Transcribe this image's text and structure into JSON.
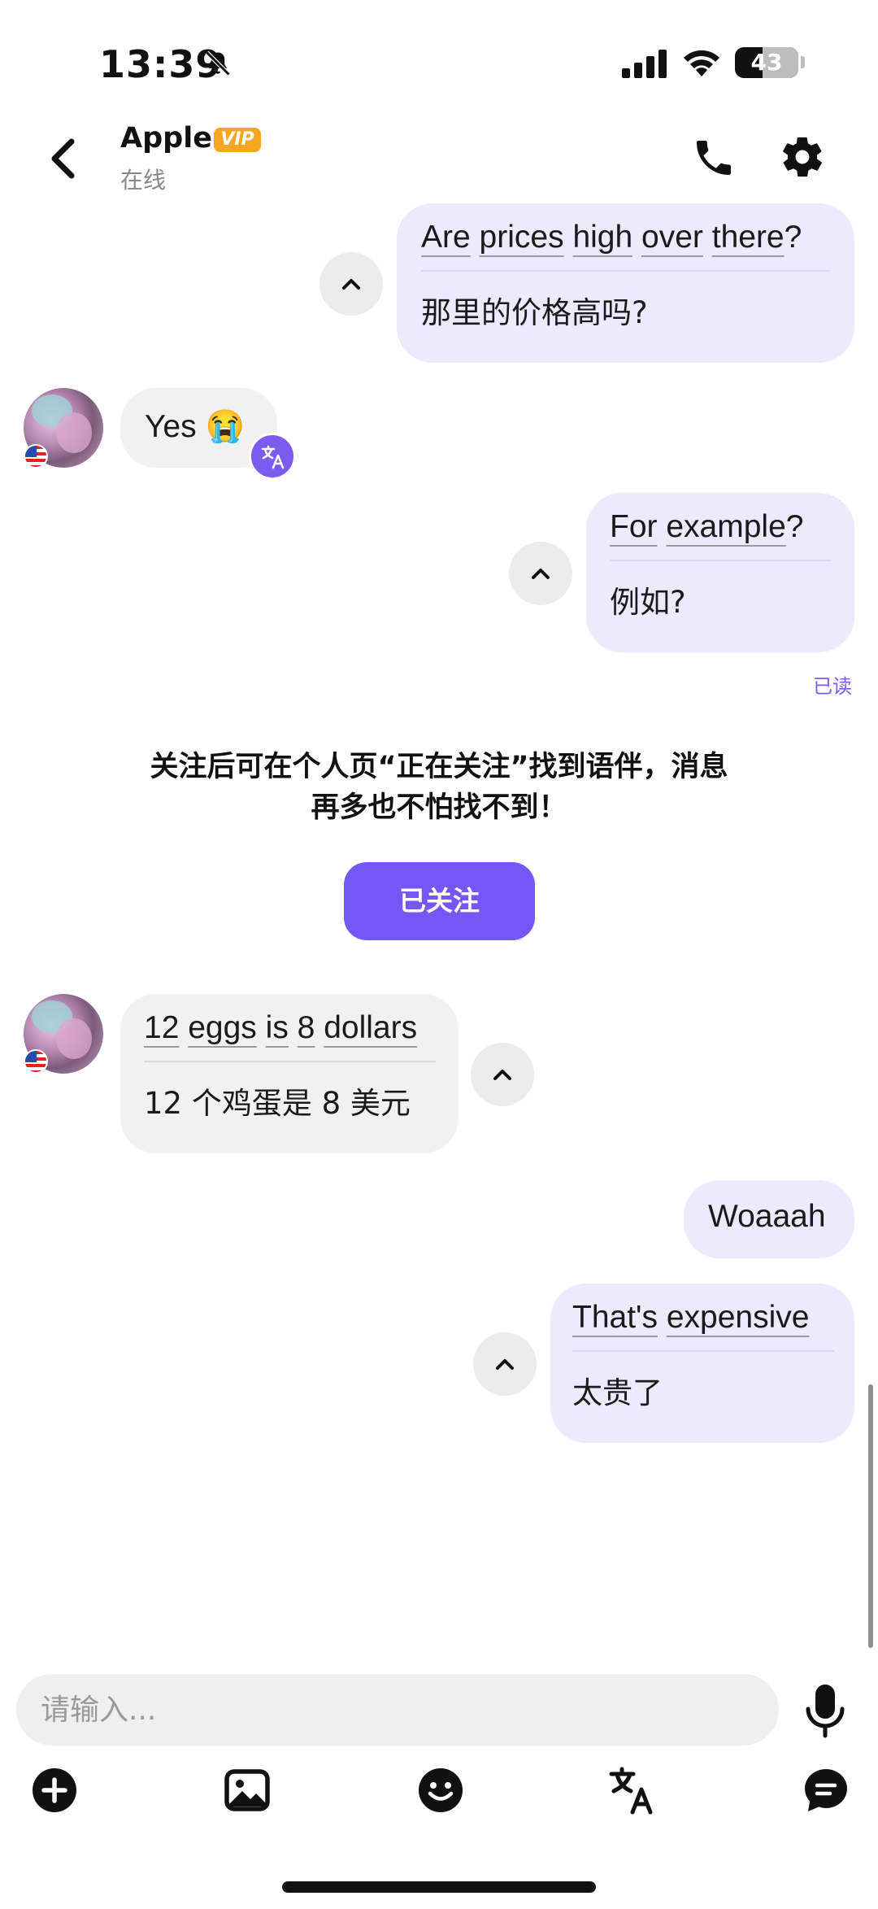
{
  "status_bar": {
    "time": "13:39",
    "battery": "43"
  },
  "header": {
    "name": "Apple",
    "vip": "VIP",
    "status": "在线"
  },
  "messages": {
    "m1": {
      "words": [
        "Are",
        "prices",
        "high",
        "over",
        "there"
      ],
      "punct": "?",
      "translation": "那里的价格高吗?"
    },
    "m2": {
      "text": "Yes 😭"
    },
    "m3": {
      "words": [
        "For",
        "example"
      ],
      "punct": "?",
      "translation": "例如?",
      "read": "已读"
    },
    "m4": {
      "words": [
        "12",
        "eggs",
        "is",
        "8",
        "dollars"
      ],
      "translation": "12 个鸡蛋是 8 美元"
    },
    "m5": {
      "text": "Woaaah"
    },
    "m6": {
      "words": [
        "That's",
        "expensive"
      ],
      "translation": "太贵了"
    }
  },
  "notice": {
    "line1": "关注后可在个人页“正在关注”找到语伴，消息",
    "line2": "再多也不怕找不到！",
    "button": "已关注"
  },
  "input": {
    "placeholder": "请输入..."
  },
  "toolbar": [
    "add-icon",
    "image-icon",
    "emoji-icon",
    "translate-icon",
    "chat-bubble-icon"
  ],
  "colors": {
    "accent": "#7557f5",
    "outgoing_bubble": "#ede9fe",
    "incoming_bubble": "#f1f1f1",
    "vip": "#f5a623"
  }
}
